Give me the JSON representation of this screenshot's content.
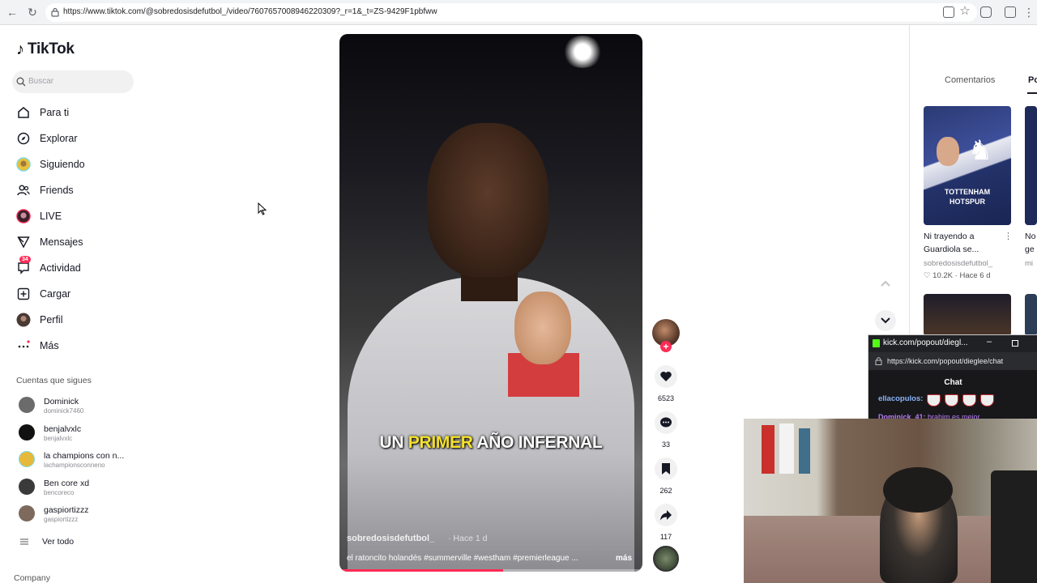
{
  "browser": {
    "url": "https://www.tiktok.com/@sobredosisdefutbol_/video/7607657008946220309?_r=1&_t=ZS-9429F1pbfww"
  },
  "sidebar": {
    "logo": "TikTok",
    "search_placeholder": "Buscar",
    "menu": [
      {
        "label": "Para ti",
        "icon": "home-icon"
      },
      {
        "label": "Explorar",
        "icon": "compass-icon"
      },
      {
        "label": "Siguiendo",
        "icon": "following-avatar-icon"
      },
      {
        "label": "Friends",
        "icon": "friends-icon"
      },
      {
        "label": "LIVE",
        "icon": "live-avatar-icon"
      },
      {
        "label": "Mensajes",
        "icon": "send-icon"
      },
      {
        "label": "Actividad",
        "icon": "activity-icon",
        "badge": "34"
      },
      {
        "label": "Cargar",
        "icon": "upload-icon"
      },
      {
        "label": "Perfil",
        "icon": "profile-avatar-icon"
      },
      {
        "label": "Más",
        "icon": "more-dots-icon"
      }
    ],
    "following_title": "Cuentas que sigues",
    "following": [
      {
        "name": "Dominick",
        "handle": "dominick7460",
        "color": "#6b6b6b"
      },
      {
        "name": "benjalvxlc",
        "handle": "benjalvxlc",
        "color": "#111111"
      },
      {
        "name": "la champions con n...",
        "handle": "lachampionsconneno",
        "color": "#e6b93c"
      },
      {
        "name": "Ben core xd",
        "handle": "bencoreco",
        "color": "#3a3a3a"
      },
      {
        "name": "gaspiortizzz",
        "handle": "gaspiortizzz",
        "color": "#7d6a5d"
      }
    ],
    "see_all": "Ver todo",
    "footer": "Company"
  },
  "video": {
    "caption_pre": "UN ",
    "caption_highlight": "PRIMER",
    "caption_post": " AÑO INFERNAL",
    "author": "sobredosisdefutbol_",
    "time": "· Hace 1 d",
    "description": "el ratoncito holandés #summerville #westham #premierleague ...",
    "more": "más",
    "progress": 0.54
  },
  "actions": {
    "likes": "6523",
    "comments": "33",
    "saves": "262",
    "shares": "117"
  },
  "right_panel": {
    "tabs": [
      "Comentarios",
      "Po"
    ],
    "videos": [
      {
        "title": "Ni trayendo a Guardiola se...",
        "author": "sobredosisdefutbol_",
        "likes": "10.2K",
        "time": "Hace 6 d"
      },
      {
        "title": "No ge",
        "author": "mi"
      }
    ],
    "thumb_text": "TOTTENHAM HOTSPUR"
  },
  "kick_popout": {
    "title": "kick.com/popout/diegl...",
    "url": "https://kick.com/popout/dieglee/chat",
    "chat_title": "Chat",
    "msg1_user": "ellacopulos:",
    "msg2_user": "Dominick_41:",
    "msg2_text": " brahim es mejor"
  }
}
